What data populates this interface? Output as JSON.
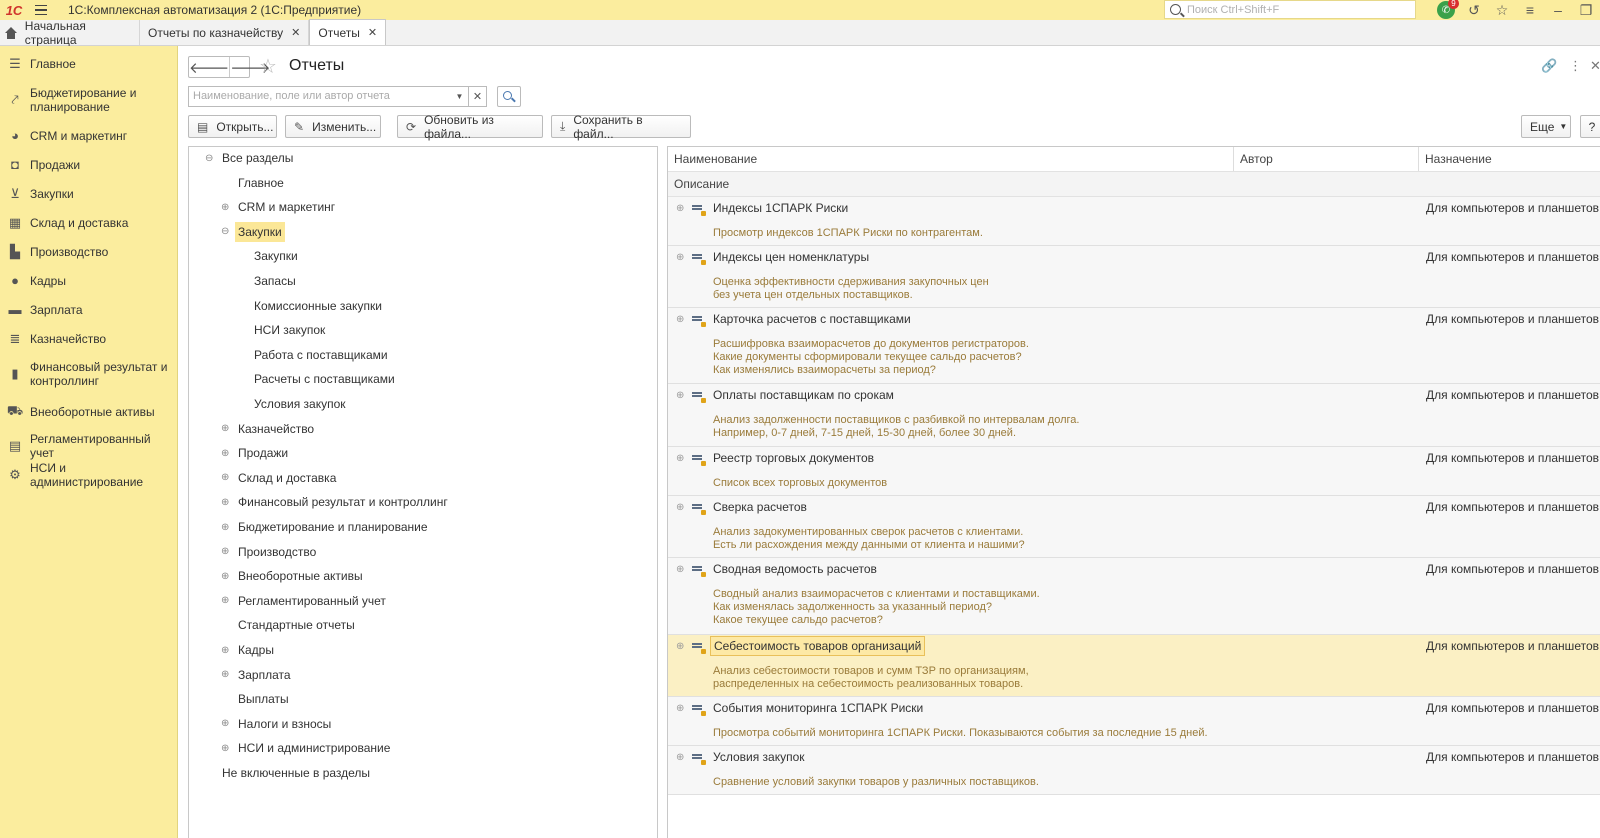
{
  "app": {
    "logo": "1С",
    "title": "1С:Комплексная автоматизация 2  (1С:Предприятие)",
    "search_placeholder": "Поиск Ctrl+Shift+F",
    "notification_count": "9"
  },
  "tabs": [
    {
      "label": "Начальная страница"
    },
    {
      "label": "Отчеты по казначейству"
    },
    {
      "label": "Отчеты"
    }
  ],
  "sidebar": {
    "items": [
      {
        "label": "Главное",
        "icon": "menu-icon"
      },
      {
        "label": "Бюджетирование и планирование",
        "icon": "budget-chart-icon"
      },
      {
        "label": "CRM и маркетинг",
        "icon": "pie-chart-icon"
      },
      {
        "label": "Продажи",
        "icon": "bag-icon"
      },
      {
        "label": "Закупки",
        "icon": "cart-icon"
      },
      {
        "label": "Склад и доставка",
        "icon": "warehouse-icon"
      },
      {
        "label": "Производство",
        "icon": "factory-icon"
      },
      {
        "label": "Кадры",
        "icon": "person-icon"
      },
      {
        "label": "Зарплата",
        "icon": "wallet-icon"
      },
      {
        "label": "Казначейство",
        "icon": "coins-icon"
      },
      {
        "label": "Финансовый результат и контроллинг",
        "icon": "bar-chart-icon"
      },
      {
        "label": "Внеоборотные активы",
        "icon": "truck-icon"
      },
      {
        "label": "Регламентированный учет",
        "icon": "calculator-icon"
      },
      {
        "label": "НСИ и администрирование",
        "icon": "gear-icon"
      }
    ]
  },
  "header": {
    "title": "Отчеты"
  },
  "search": {
    "placeholder": "Наименование, поле или автор отчета"
  },
  "toolbar": {
    "open": "Открыть...",
    "edit": "Изменить...",
    "update": "Обновить из файла...",
    "save": "Сохранить в файл...",
    "more": "Еще",
    "help": "?"
  },
  "tree": [
    {
      "label": "Все разделы",
      "exp": "⊖",
      "level": 0
    },
    {
      "label": "Главное",
      "exp": "",
      "level": 1
    },
    {
      "label": "CRM и маркетинг",
      "exp": "⊕",
      "level": 1
    },
    {
      "label": "Закупки",
      "exp": "⊖",
      "level": 1,
      "selected": true
    },
    {
      "label": "Закупки",
      "exp": "",
      "level": 2
    },
    {
      "label": "Запасы",
      "exp": "",
      "level": 2
    },
    {
      "label": "Комиссионные закупки",
      "exp": "",
      "level": 2
    },
    {
      "label": "НСИ закупок",
      "exp": "",
      "level": 2
    },
    {
      "label": "Работа с поставщиками",
      "exp": "",
      "level": 2
    },
    {
      "label": "Расчеты с поставщиками",
      "exp": "",
      "level": 2
    },
    {
      "label": "Условия закупок",
      "exp": "",
      "level": 2
    },
    {
      "label": "Казначейство",
      "exp": "⊕",
      "level": 1
    },
    {
      "label": "Продажи",
      "exp": "⊕",
      "level": 1
    },
    {
      "label": "Склад и доставка",
      "exp": "⊕",
      "level": 1
    },
    {
      "label": "Финансовый результат и контроллинг",
      "exp": "⊕",
      "level": 1
    },
    {
      "label": "Бюджетирование и планирование",
      "exp": "⊕",
      "level": 1
    },
    {
      "label": "Производство",
      "exp": "⊕",
      "level": 1
    },
    {
      "label": "Внеоборотные активы",
      "exp": "⊕",
      "level": 1
    },
    {
      "label": "Регламентированный учет",
      "exp": "⊕",
      "level": 1
    },
    {
      "label": "Стандартные отчеты",
      "exp": "",
      "level": 1
    },
    {
      "label": "Кадры",
      "exp": "⊕",
      "level": 1
    },
    {
      "label": "Зарплата",
      "exp": "⊕",
      "level": 1
    },
    {
      "label": "Выплаты",
      "exp": "",
      "level": 1
    },
    {
      "label": "Налоги и взносы",
      "exp": "⊕",
      "level": 1
    },
    {
      "label": "НСИ и администрирование",
      "exp": "⊕",
      "level": 1
    },
    {
      "label": "Не включенные в разделы",
      "exp": "",
      "level": 0
    }
  ],
  "list": {
    "columns": {
      "name": "Наименование",
      "author": "Автор",
      "purpose": "Назначение",
      "description": "Описание"
    },
    "rows": [
      {
        "name": "Индексы 1СПАРК Риски",
        "description": "Просмотр индексов 1СПАРК Риски по контрагентам.",
        "purpose": "Для компьютеров и планшетов"
      },
      {
        "name": "Индексы цен номенклатуры",
        "description": "Оценка эффективности сдерживания закупочных цен\nбез учета цен отдельных поставщиков.",
        "purpose": "Для компьютеров и планшетов"
      },
      {
        "name": "Карточка расчетов с поставщиками",
        "description": "Расшифровка взаиморасчетов до документов регистраторов.\nКакие документы сформировали текущее сальдо расчетов?\nКак изменялись взаиморасчеты за период?",
        "purpose": "Для компьютеров и планшетов"
      },
      {
        "name": "Оплаты поставщикам по срокам",
        "description": "Анализ задолженности поставщиков с разбивкой по интервалам долга.\nНапример, 0-7 дней, 7-15 дней, 15-30 дней, более 30 дней.",
        "purpose": "Для компьютеров и планшетов"
      },
      {
        "name": "Реестр торговых документов",
        "description": "Список всех торговых документов",
        "purpose": "Для компьютеров и планшетов"
      },
      {
        "name": "Сверка расчетов",
        "description": "Анализ задокументированных сверок расчетов с клиентами.\nЕсть ли расхождения между данными от клиента и нашими?",
        "purpose": "Для компьютеров и планшетов"
      },
      {
        "name": "Сводная ведомость расчетов",
        "description": "Сводный анализ взаиморасчетов с клиентами и поставщиками.\nКак изменялась задолженность за указанный период?\nКакое текущее сальдо расчетов?",
        "purpose": "Для компьютеров и планшетов"
      },
      {
        "name": "Себестоимость товаров организаций",
        "description": "Анализ себестоимости товаров и сумм ТЗР по организациям,\nраспределенных на себестоимость реализованных товаров.",
        "purpose": "Для компьютеров и планшетов",
        "selected": true
      },
      {
        "name": "События мониторинга 1СПАРК Риски",
        "description": "Просмотра событий мониторинга 1СПАРК Риски. Показываются события за последние 15 дней.",
        "purpose": "Для компьютеров и планшетов"
      },
      {
        "name": "Условия закупок",
        "description": "Сравнение условий закупки товаров у различных поставщиков.",
        "purpose": "Для компьютеров и планшетов"
      }
    ]
  },
  "colors": {
    "accent_yellow": "#fbed9e",
    "selection": "#fbe797",
    "description_text": "#9a7b3a"
  }
}
